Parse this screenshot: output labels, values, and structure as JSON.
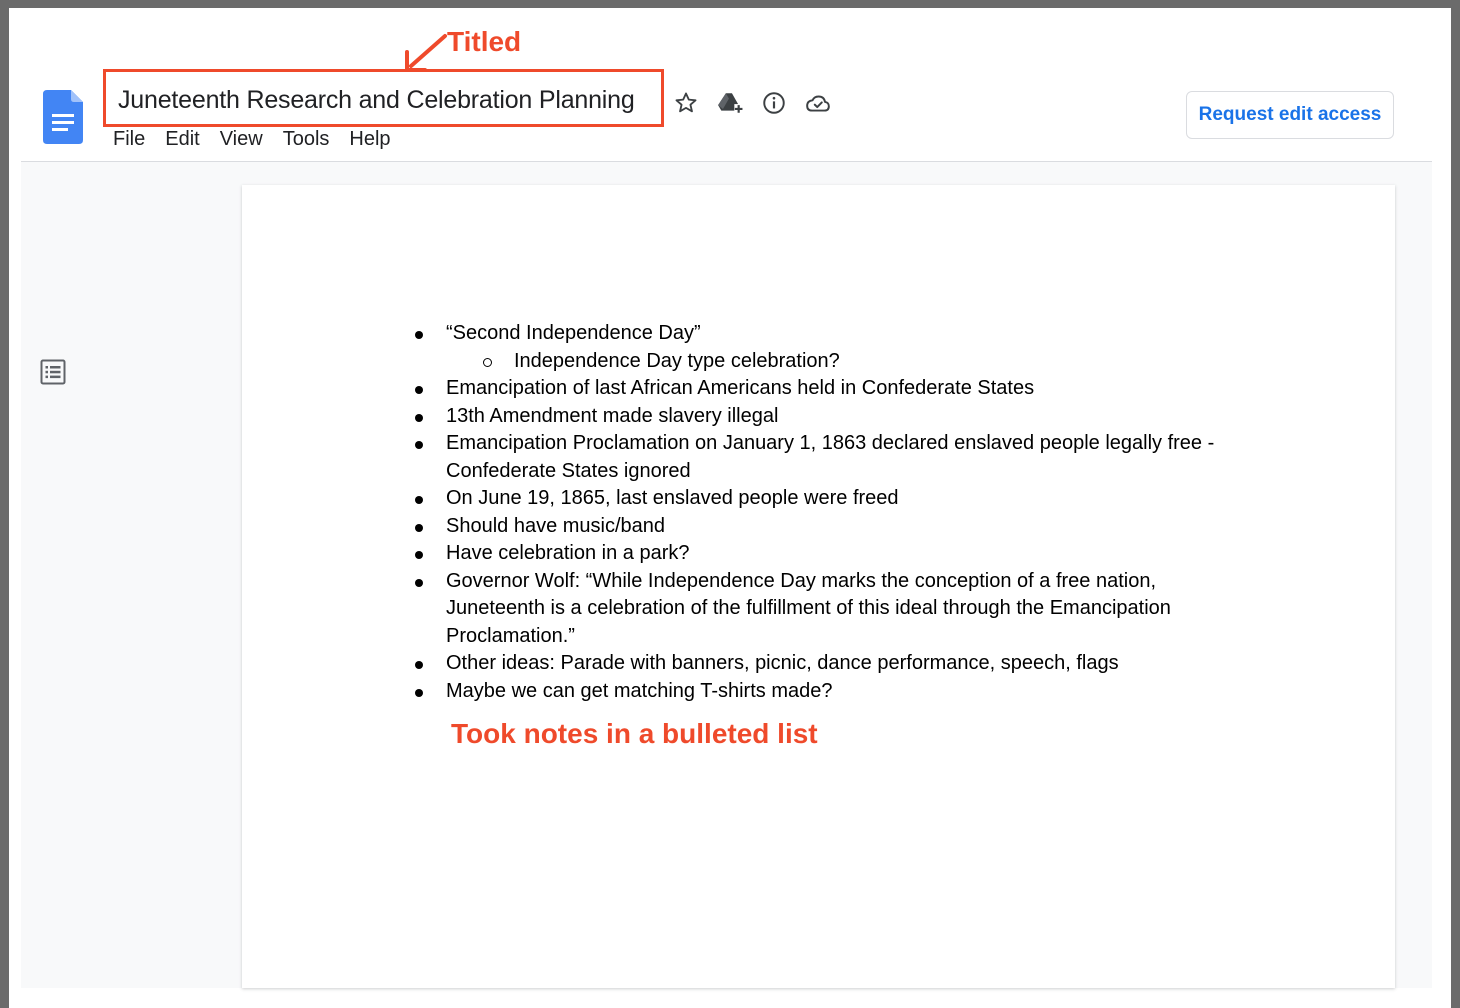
{
  "annotations": {
    "titled": "Titled",
    "notes": "Took notes in a bulleted list"
  },
  "header": {
    "document_title": "Juneteenth Research and Celebration Planning",
    "menu": [
      "File",
      "Edit",
      "View",
      "Tools",
      "Help"
    ],
    "icons": [
      "star-icon",
      "move-to-drive-icon",
      "info-icon",
      "cloud-saved-icon"
    ],
    "request_edit_label": "Request edit access"
  },
  "sidebar": {
    "outline_icon": "document-outline-icon"
  },
  "document": {
    "bullets": [
      {
        "level": 0,
        "lines": [
          "“Second Independence Day”"
        ]
      },
      {
        "level": 1,
        "lines": [
          "Independence Day type celebration?"
        ]
      },
      {
        "level": 0,
        "lines": [
          "Emancipation of last African Americans held in Confederate States"
        ]
      },
      {
        "level": 0,
        "lines": [
          "13th Amendment made slavery illegal"
        ]
      },
      {
        "level": 0,
        "lines": [
          "Emancipation Proclamation on January 1, 1863 declared enslaved people legally free -",
          "Confederate States ignored"
        ]
      },
      {
        "level": 0,
        "lines": [
          "On June 19, 1865, last enslaved people were freed"
        ]
      },
      {
        "level": 0,
        "lines": [
          "Should have music/band"
        ]
      },
      {
        "level": 0,
        "lines": [
          "Have celebration in a park?"
        ]
      },
      {
        "level": 0,
        "lines": [
          "Governor Wolf: “While Independence Day marks the conception of a free nation,",
          "Juneteenth is a celebration of the fulfillment of this ideal through the Emancipation",
          "Proclamation.”"
        ]
      },
      {
        "level": 0,
        "lines": [
          "Other ideas: Parade with banners, picnic, dance performance, speech, flags"
        ]
      },
      {
        "level": 0,
        "lines": [
          "Maybe we can get matching T-shirts made?"
        ]
      }
    ]
  },
  "colors": {
    "annotation": "#ef4a2b",
    "docs_blue": "#4285f4",
    "link_blue": "#1a73e8",
    "frame": "#6b6b6b"
  }
}
